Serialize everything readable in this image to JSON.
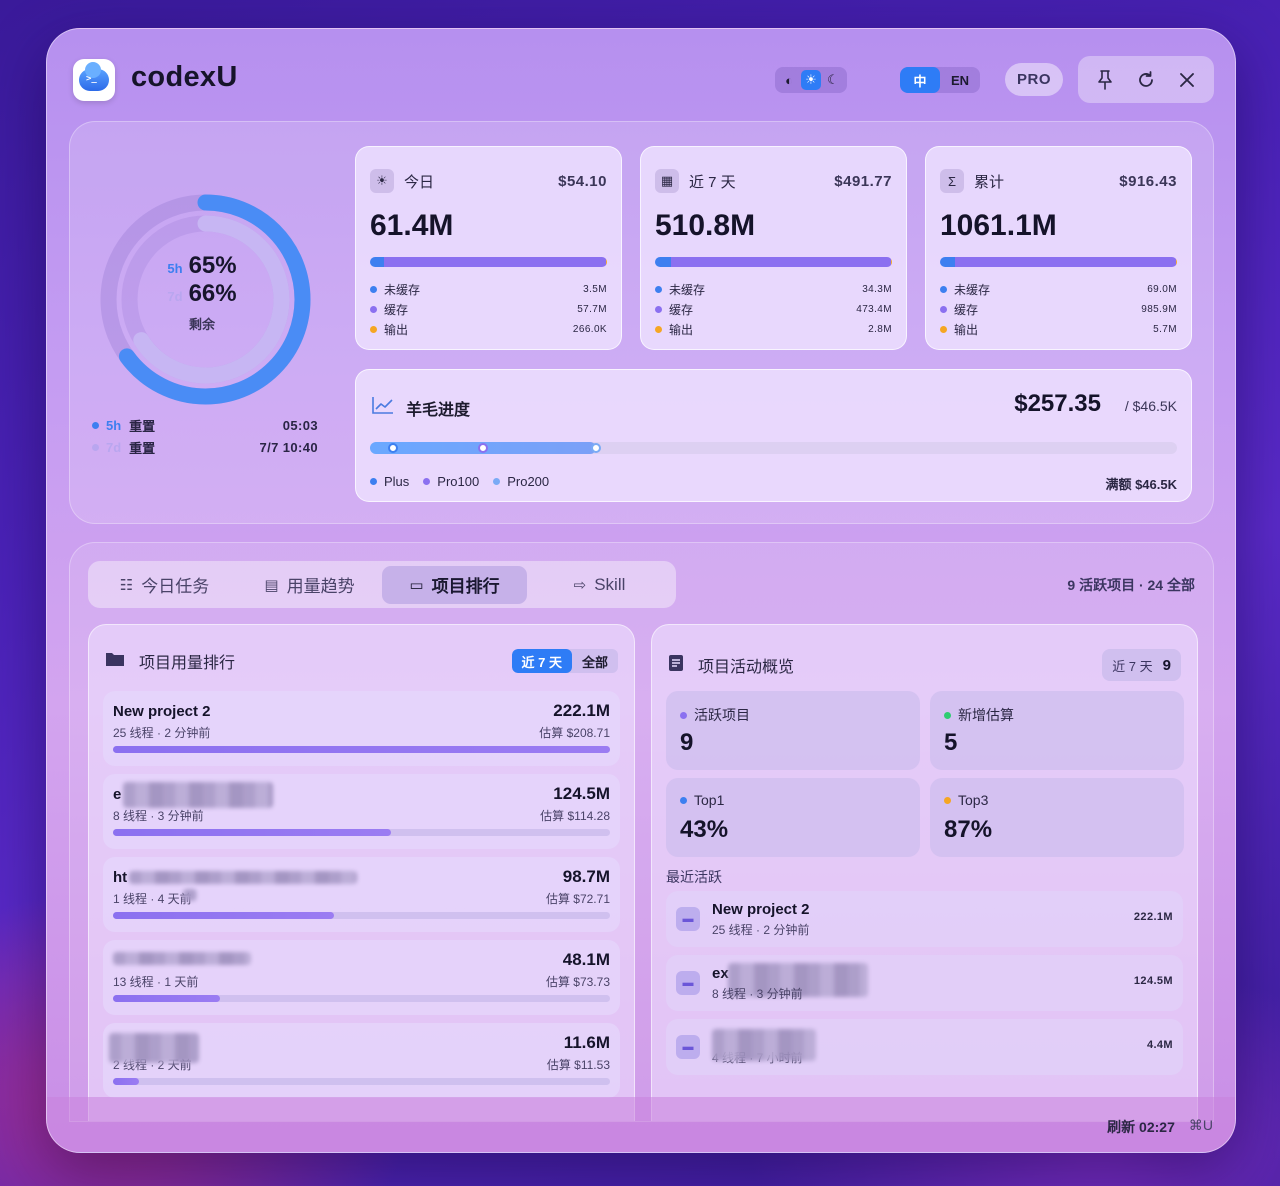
{
  "app": {
    "title": "codexU",
    "logo_text": ">_"
  },
  "header": {
    "theme": {
      "options": [
        "contrast-icon",
        "sun-icon",
        "moon-icon"
      ],
      "active": "sun-icon"
    },
    "lang": {
      "zh": "中",
      "en": "EN",
      "active": "zh"
    },
    "pro_label": "PRO",
    "actions": [
      "pin-icon",
      "refresh-icon",
      "close-icon"
    ]
  },
  "ring": {
    "five_h": {
      "key": "5h",
      "pct": "65%",
      "value": 0.65,
      "color": "#4a8cf5"
    },
    "seven_d": {
      "key": "7d",
      "pct": "66%",
      "value": 0.66,
      "color": "#c7b6f3"
    },
    "remaining_label": "剩余",
    "resets": [
      {
        "key": "5h",
        "label": "重置",
        "value": "05:03",
        "color": "#3d7ff0"
      },
      {
        "key": "7d",
        "label": "重置",
        "value": "7/7 10:40",
        "color": "#b9a6ef"
      }
    ]
  },
  "stats": [
    {
      "icon": "sun-icon",
      "icon_glyph": "☀",
      "label": "今日",
      "cost": "$54.10",
      "total": "61.4M",
      "segments": [
        {
          "name": "未缓存",
          "value": "3.5M",
          "frac": 0.057,
          "color": "#3d7ff0"
        },
        {
          "name": "缓存",
          "value": "57.7M",
          "frac": 0.938,
          "color": "#8b70f0"
        },
        {
          "name": "输出",
          "value": "266.0K",
          "frac": 0.005,
          "color": "#f5a623"
        }
      ]
    },
    {
      "icon": "calendar-icon",
      "icon_glyph": "▦",
      "label": "近 7 天",
      "cost": "$491.77",
      "total": "510.8M",
      "segments": [
        {
          "name": "未缓存",
          "value": "34.3M",
          "frac": 0.067,
          "color": "#3d7ff0"
        },
        {
          "name": "缓存",
          "value": "473.4M",
          "frac": 0.927,
          "color": "#8b70f0"
        },
        {
          "name": "输出",
          "value": "2.8M",
          "frac": 0.006,
          "color": "#f5a623"
        }
      ]
    },
    {
      "icon": "sigma-icon",
      "icon_glyph": "Σ",
      "label": "累计",
      "cost": "$916.43",
      "total": "1061.1M",
      "segments": [
        {
          "name": "未缓存",
          "value": "69.0M",
          "frac": 0.065,
          "color": "#3d7ff0"
        },
        {
          "name": "缓存",
          "value": "985.9M",
          "frac": 0.929,
          "color": "#8b70f0"
        },
        {
          "name": "输出",
          "value": "5.7M",
          "frac": 0.006,
          "color": "#f5a623"
        }
      ]
    }
  ],
  "progress": {
    "icon": "trend-icon",
    "title": "羊毛进度",
    "amount": "$257.35",
    "total": "/ $46.5K",
    "fill": 0.28,
    "markers": [
      {
        "name": "Plus",
        "pos": 0.028,
        "color": "#3d7ff0"
      },
      {
        "name": "Pro100",
        "pos": 0.14,
        "color": "#8b70f0"
      },
      {
        "name": "Pro200",
        "pos": 0.28,
        "color": "#7aaaf5"
      }
    ],
    "cap_label": "满额 $46.5K"
  },
  "tabs": [
    {
      "icon": "list-icon",
      "glyph": "☷",
      "label": "今日任务",
      "active": false
    },
    {
      "icon": "calendar-icon",
      "glyph": "▤",
      "label": "用量趋势",
      "active": false
    },
    {
      "icon": "folder-icon",
      "glyph": "▭",
      "label": "项目排行",
      "active": true
    },
    {
      "icon": "skill-icon",
      "glyph": "⇨",
      "label": "Skill",
      "active": false
    }
  ],
  "project_summary": "9 活跃项目 · 24 全部",
  "ranking": {
    "icon": "folder-icon",
    "title": "项目用量排行",
    "seg": {
      "recent": "近 7 天",
      "all": "全部",
      "active": "recent"
    },
    "items": [
      {
        "name": "New project 2",
        "meta": "25 线程 · 2 分钟前",
        "tokens": "222.1M",
        "cost": "估算 $208.71",
        "frac": 1.0,
        "masked": false
      },
      {
        "name": "e",
        "meta": "8 线程 · 3 分钟前",
        "tokens": "124.5M",
        "cost": "估算 $114.28",
        "frac": 0.56,
        "masked": true
      },
      {
        "name": "ht",
        "meta": "1 线程 · 4 天前",
        "tokens": "98.7M",
        "cost": "估算 $72.71",
        "frac": 0.445,
        "masked": true
      },
      {
        "name": "",
        "meta": "13 线程 · 1 天前",
        "tokens": "48.1M",
        "cost": "估算 $73.73",
        "frac": 0.216,
        "masked": true
      },
      {
        "name": "",
        "meta": "2 线程 · 2 天前",
        "tokens": "11.6M",
        "cost": "估算 $11.53",
        "frac": 0.052,
        "masked": true
      }
    ]
  },
  "activity": {
    "icon": "doc-icon",
    "title": "项目活动概览",
    "badge_label": "近 7 天",
    "badge_value": "9",
    "kpis": [
      {
        "label": "活跃项目",
        "value": "9",
        "color": "#8b70f0"
      },
      {
        "label": "新增估算",
        "value": "5",
        "color": "#2ecc71"
      },
      {
        "label": "Top1",
        "value": "43%",
        "color": "#3d7ff0"
      },
      {
        "label": "Top3",
        "value": "87%",
        "color": "#f5a623"
      }
    ],
    "recent_title": "最近活跃",
    "recent": [
      {
        "name": "New project 2",
        "meta": "25 线程 · 2 分钟前",
        "value": "222.1M",
        "masked": false
      },
      {
        "name": "ex",
        "meta": "8 线程 · 3 分钟前",
        "value": "124.5M",
        "masked": true
      },
      {
        "name": "",
        "meta": "4 线程 · 7 小时前",
        "value": "4.4M",
        "masked": true
      }
    ]
  },
  "footer": {
    "refresh": "刷新 02:27",
    "shortcut": "⌘U"
  }
}
